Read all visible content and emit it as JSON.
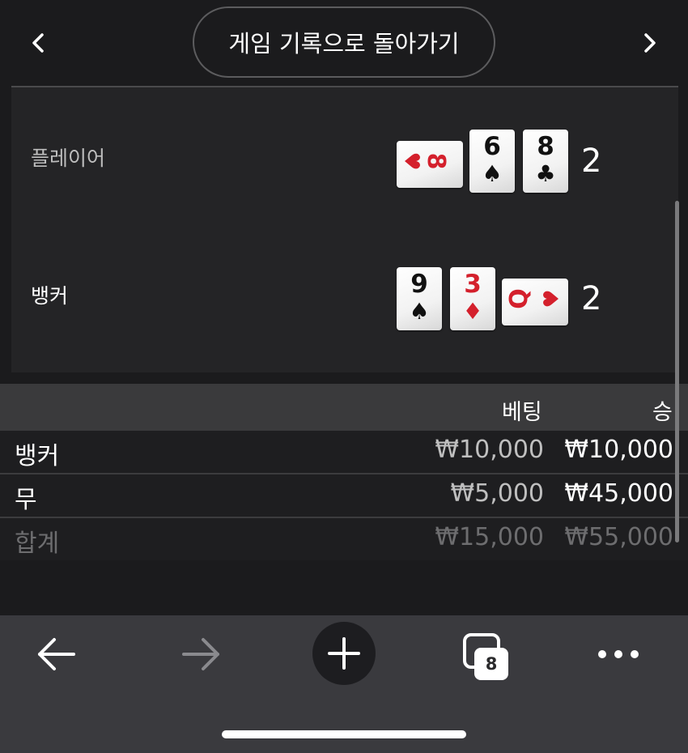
{
  "header": {
    "back_to_history_label": "게임 기록으로 돌아가기",
    "prev_icon": "chevron-left-icon",
    "next_icon": "chevron-right-icon"
  },
  "hands": {
    "player": {
      "label": "플레이어",
      "score": "2",
      "cards": [
        {
          "rank": "8",
          "suit": "♥",
          "color": "#d4202c",
          "orientation": "sideways"
        },
        {
          "rank": "6",
          "suit": "♠",
          "color": "#111111",
          "orientation": "upright"
        },
        {
          "rank": "8",
          "suit": "♣",
          "color": "#111111",
          "orientation": "upright"
        }
      ]
    },
    "banker": {
      "label": "뱅커",
      "score": "2",
      "cards": [
        {
          "rank": "9",
          "suit": "♠",
          "color": "#111111",
          "orientation": "upright"
        },
        {
          "rank": "3",
          "suit": "♦",
          "color": "#d4202c",
          "orientation": "upright"
        },
        {
          "rank": "Q",
          "suit": "♥",
          "color": "#d4202c",
          "orientation": "sideways"
        }
      ]
    }
  },
  "bets": {
    "columns": {
      "bet": "베팅",
      "win": "승"
    },
    "rows": [
      {
        "label": "뱅커",
        "bet": "₩10,000",
        "win": "₩10,000"
      },
      {
        "label": "무",
        "bet": "₩5,000",
        "win": "₩45,000"
      }
    ],
    "total": {
      "label": "합계",
      "bet": "₩15,000",
      "win": "₩55,000"
    }
  },
  "browser_bar": {
    "back_icon": "arrow-left-icon",
    "forward_icon": "arrow-right-icon",
    "new_tab_icon": "plus-icon",
    "tabs_icon": "tabs-icon",
    "tab_count": "8",
    "more_icon": "more-horizontal-icon"
  },
  "colors": {
    "background": "#1b1b1d",
    "panel": "#242426",
    "table_header": "#3a3a3c",
    "card_red": "#d4202c",
    "browser_bar": "#3a3a3e"
  }
}
